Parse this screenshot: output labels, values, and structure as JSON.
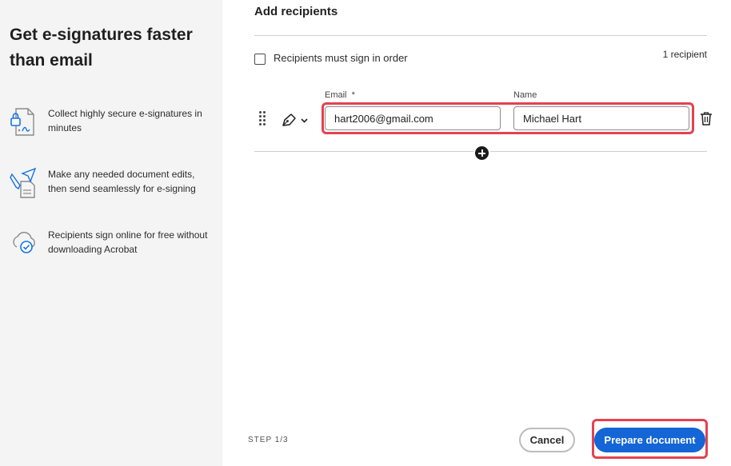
{
  "left_panel": {
    "heading": "Get e-signatures faster than email",
    "features": [
      {
        "icon": "secure-document-icon",
        "text": "Collect highly secure e-signatures in minutes"
      },
      {
        "icon": "edit-send-icon",
        "text": "Make any needed document edits, then send seamlessly for e-signing"
      },
      {
        "icon": "cloud-check-icon",
        "text": "Recipients sign online for free without downloading Acrobat"
      }
    ]
  },
  "main": {
    "title": "Add recipients",
    "sign_in_order_label": "Recipients must sign in order",
    "sign_in_order_checked": false,
    "recipient_count": "1 recipient",
    "email_label": "Email",
    "required_marker": "*",
    "name_label": "Name",
    "recipients": [
      {
        "email": "hart2006@gmail.com",
        "name": "Michael Hart",
        "role_icon": "pen-icon"
      }
    ]
  },
  "footer": {
    "step": "STEP 1/3",
    "cancel_label": "Cancel",
    "primary_label": "Prepare document"
  },
  "colors": {
    "primary": "#1465d6",
    "highlight": "#e3424f",
    "left_bg": "#f4f4f4"
  }
}
